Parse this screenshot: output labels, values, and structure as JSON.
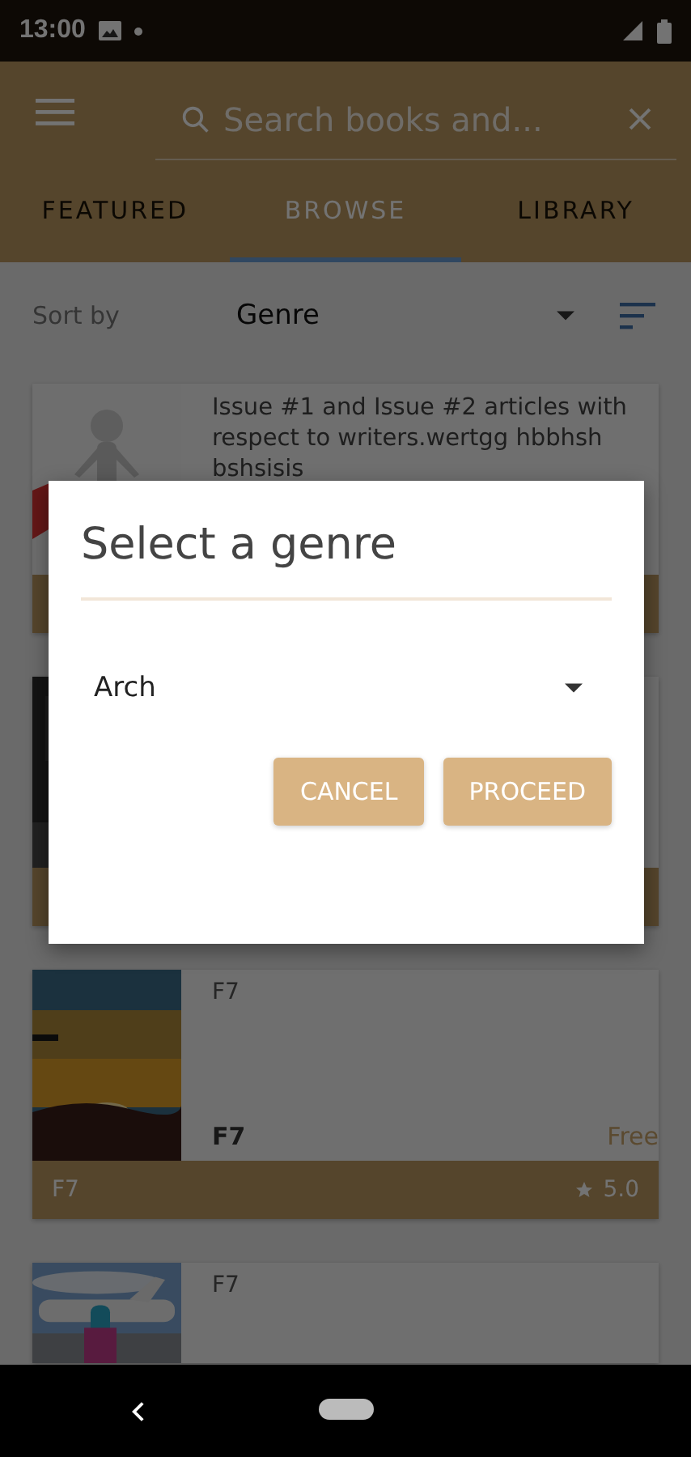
{
  "status_bar": {
    "time": "13:00"
  },
  "search": {
    "placeholder": "Search books and..."
  },
  "tabs": [
    {
      "label": "FEATURED",
      "selected": false
    },
    {
      "label": "BROWSE",
      "selected": true
    },
    {
      "label": "LIBRARY",
      "selected": false
    }
  ],
  "sort": {
    "label": "Sort by",
    "value": "Genre"
  },
  "books": [
    {
      "description": "Issue #1 and Issue #2 articles with respect to writers.wertgg hbbhsh bshsisis"
    },
    {
      "kind": "picture"
    },
    {
      "title": "F7",
      "author": "F7",
      "price": "Free",
      "category": "F7",
      "rating": "5.0"
    },
    {
      "title": "F7"
    }
  ],
  "dialog": {
    "title": "Select a genre",
    "value": "Arch",
    "buttons": [
      "CANCEL",
      "PROCEED"
    ]
  }
}
